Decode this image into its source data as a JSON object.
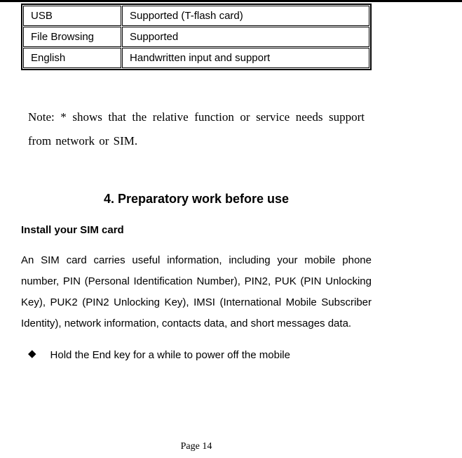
{
  "spec_table": {
    "rows": [
      {
        "label": "USB",
        "value": "Supported (T-flash card)"
      },
      {
        "label": "File Browsing",
        "value": "Supported"
      },
      {
        "label": "English",
        "value": "Handwritten input and support"
      }
    ]
  },
  "note": "Note: * shows that the relative function or service needs support from network or SIM.",
  "section_heading": "4. Preparatory work before use",
  "sub_heading": "Install your SIM card",
  "body_paragraph": "An SIM card carries useful information, including your mobile phone number, PIN (Personal Identification Number), PIN2, PUK (PIN Unlocking Key), PUK2 (PIN2 Unlocking Key), IMSI (International Mobile Subscriber Identity), network information, contacts data, and short messages data.",
  "bullet_item": "Hold the End key for a while to power off the mobile",
  "page_number": "Page 14"
}
